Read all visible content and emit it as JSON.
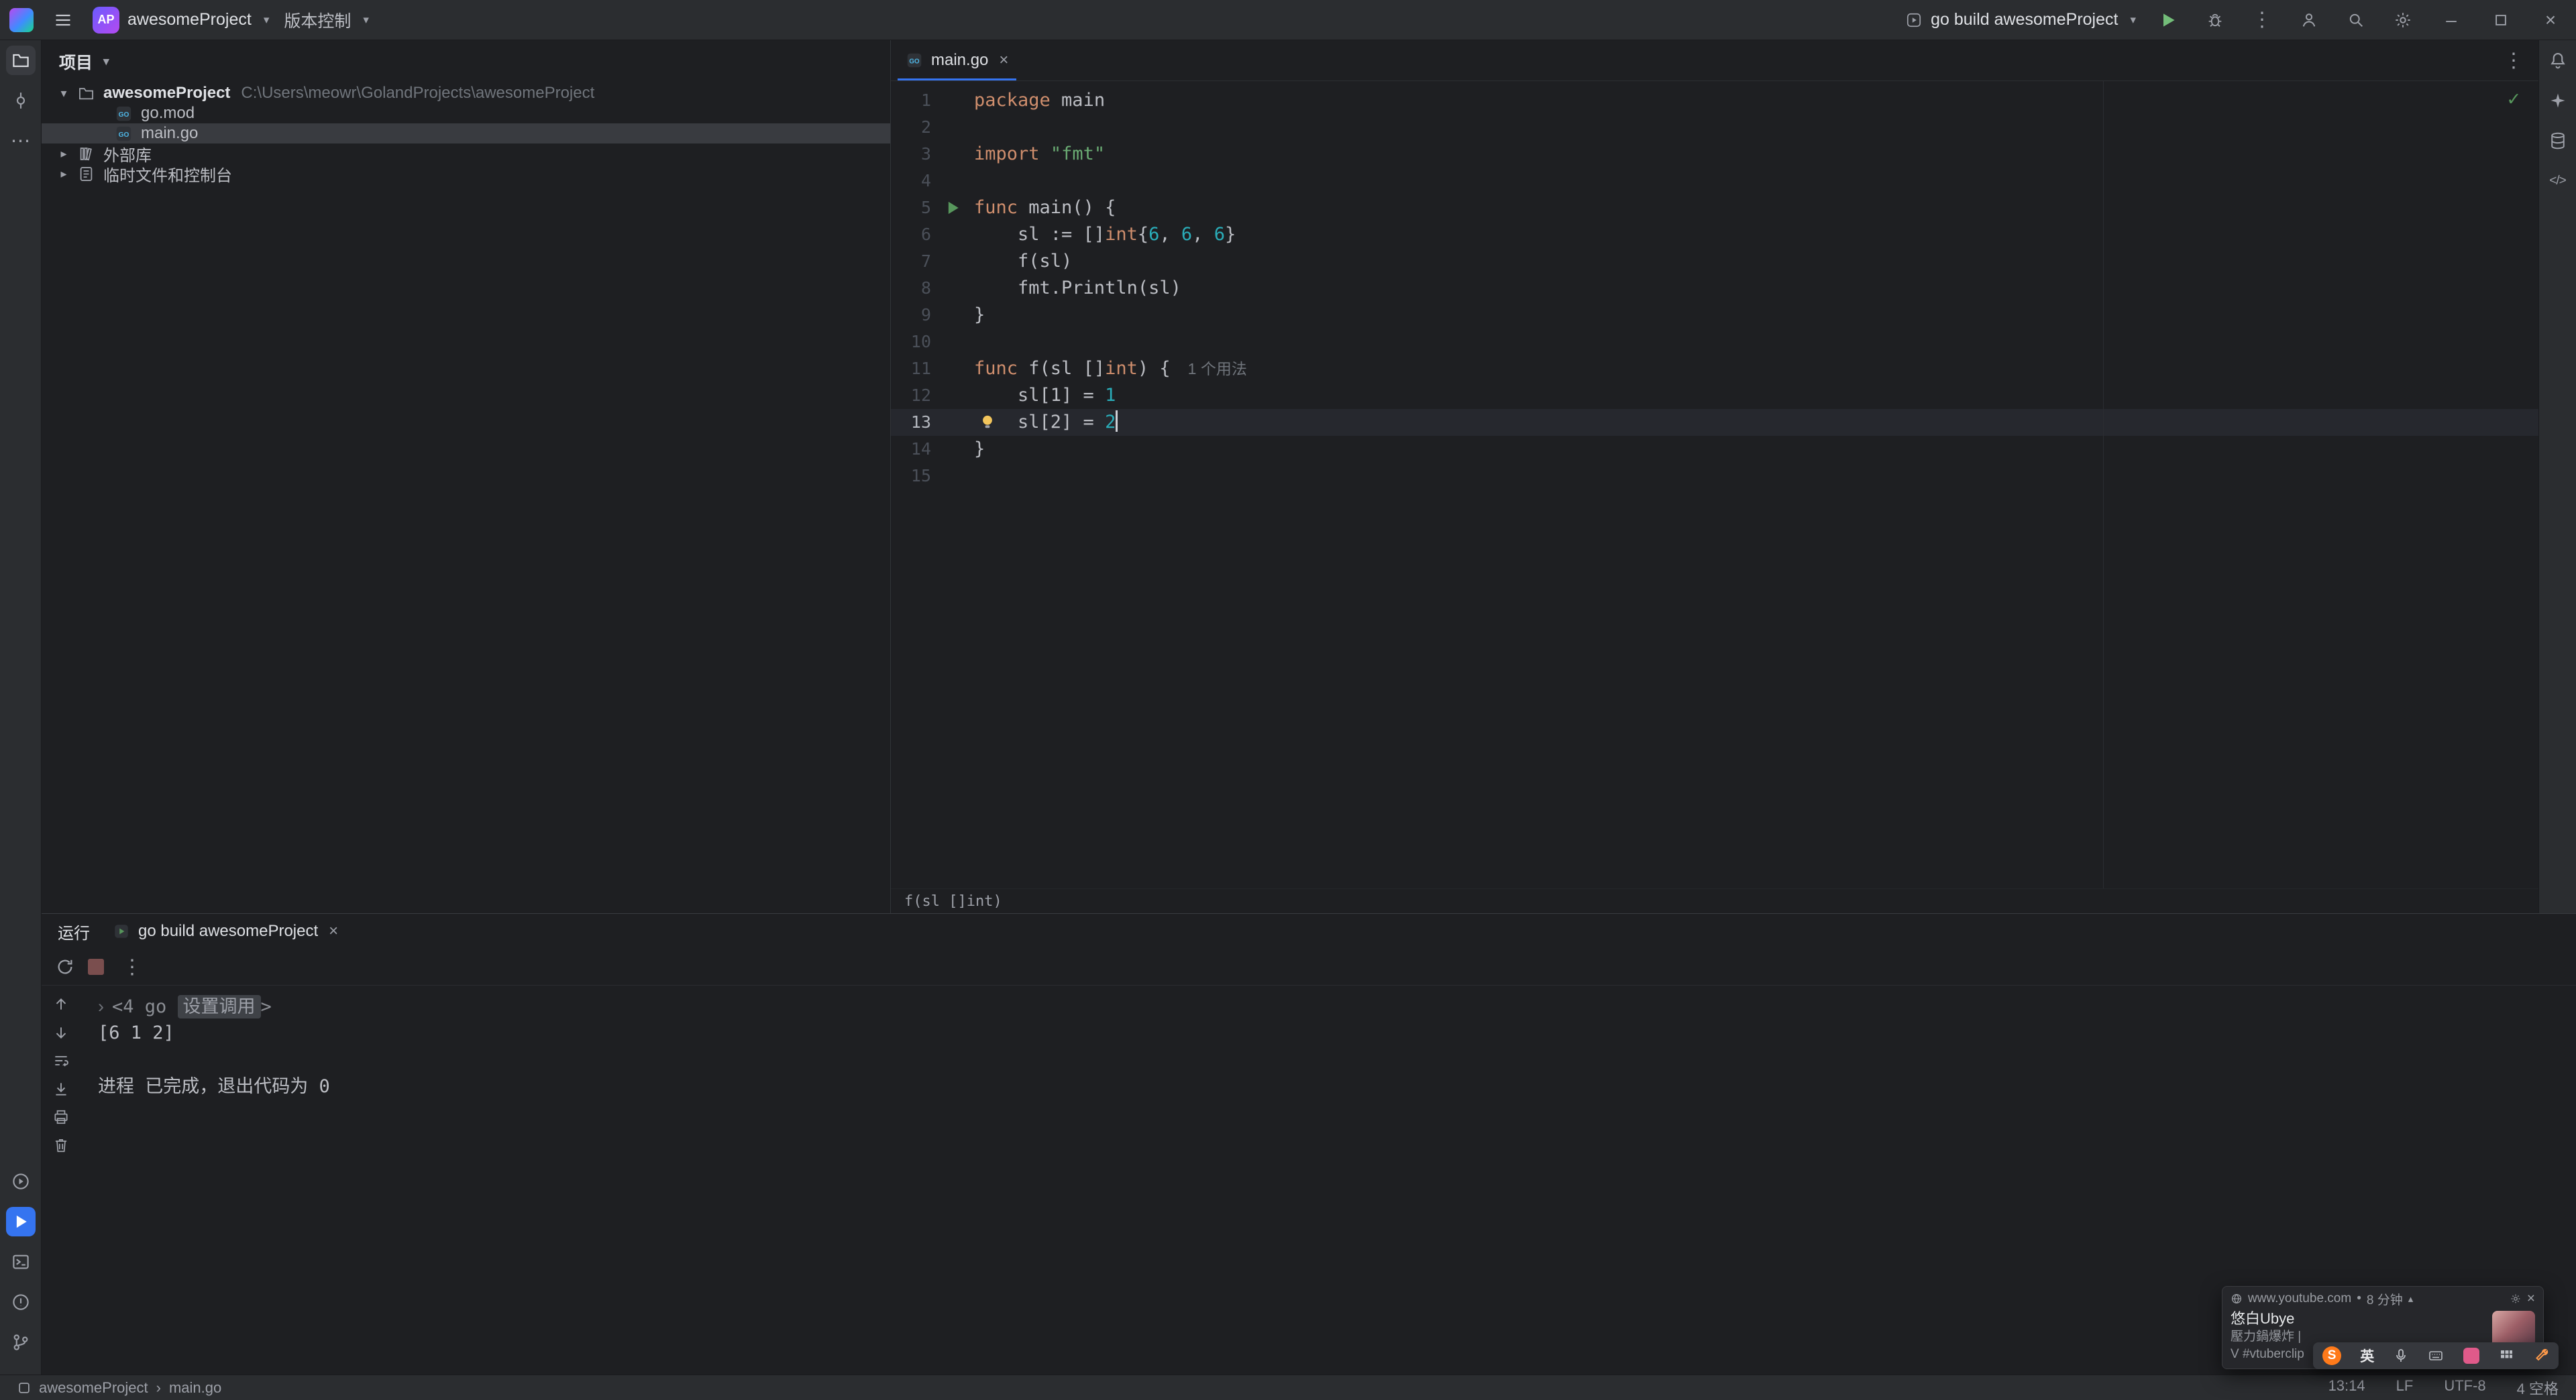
{
  "title_bar": {
    "project_name": "awesomeProject",
    "project_badge": "AP",
    "vcs_label": "版本控制",
    "run_config_label": "go build awesomeProject"
  },
  "project_panel": {
    "header_label": "项目",
    "items": [
      {
        "id": "root",
        "label": "awesomeProject",
        "path": "C:\\Users\\meowr\\GolandProjects\\awesomeProject",
        "icon": "folder",
        "level": 0,
        "chev": "open",
        "bold": true,
        "selected": false
      },
      {
        "id": "go-mod",
        "label": "go.mod",
        "icon": "gofile",
        "level": 1,
        "chev": "none",
        "bold": false,
        "selected": false
      },
      {
        "id": "main-go",
        "label": "main.go",
        "icon": "gofile",
        "level": 1,
        "chev": "none",
        "bold": false,
        "selected": true
      },
      {
        "id": "external-libraries",
        "label": "外部库",
        "icon": "library",
        "level": 0,
        "chev": "closed",
        "bold": false,
        "selected": false
      },
      {
        "id": "scratches",
        "label": "临时文件和控制台",
        "icon": "scratch",
        "level": 0,
        "chev": "closed",
        "bold": false,
        "selected": false
      }
    ]
  },
  "editor": {
    "tab_label": "main.go",
    "breadcrumb": "f(sl []int)",
    "lines": [
      {
        "n": 1,
        "segs": [
          [
            "kw",
            "package"
          ],
          [
            "d",
            " main"
          ]
        ]
      },
      {
        "n": 2,
        "segs": []
      },
      {
        "n": 3,
        "segs": [
          [
            "kw",
            "import"
          ],
          [
            "d",
            " "
          ],
          [
            "str",
            "\"fmt\""
          ]
        ]
      },
      {
        "n": 4,
        "segs": []
      },
      {
        "n": 5,
        "run": true,
        "segs": [
          [
            "kw",
            "func"
          ],
          [
            "d",
            " main() {"
          ]
        ]
      },
      {
        "n": 6,
        "segs": [
          [
            "d",
            "    sl := []"
          ],
          [
            "kw",
            "int"
          ],
          [
            "d",
            "{"
          ],
          [
            "num",
            "6"
          ],
          [
            "d",
            ", "
          ],
          [
            "num",
            "6"
          ],
          [
            "d",
            ", "
          ],
          [
            "num",
            "6"
          ],
          [
            "d",
            "}"
          ]
        ]
      },
      {
        "n": 7,
        "segs": [
          [
            "d",
            "    f(sl)"
          ]
        ]
      },
      {
        "n": 8,
        "segs": [
          [
            "d",
            "    fmt.Println(sl)"
          ]
        ]
      },
      {
        "n": 9,
        "segs": [
          [
            "d",
            "}"
          ]
        ]
      },
      {
        "n": 10,
        "segs": []
      },
      {
        "n": 11,
        "segs": [
          [
            "kw",
            "func"
          ],
          [
            "d",
            " f(sl []"
          ],
          [
            "kw",
            "int"
          ],
          [
            "d",
            ") {"
          ],
          [
            "hint",
            "1 个用法"
          ]
        ]
      },
      {
        "n": 12,
        "segs": [
          [
            "d",
            "    sl[1] = "
          ],
          [
            "num",
            "1"
          ]
        ]
      },
      {
        "n": 13,
        "current": true,
        "bulb": true,
        "segs": [
          [
            "d",
            "    sl[2] = "
          ],
          [
            "num",
            "2"
          ],
          [
            "caret",
            ""
          ]
        ]
      },
      {
        "n": 14,
        "segs": [
          [
            "d",
            "}"
          ]
        ]
      },
      {
        "n": 15,
        "segs": []
      }
    ]
  },
  "run_panel": {
    "title": "运行",
    "tab_label": "go build awesomeProject",
    "console": [
      {
        "segs": [
          [
            "chev",
            "›"
          ],
          [
            "meta",
            "<4 go "
          ],
          [
            "metabox",
            "设置调用"
          ],
          [
            "meta",
            ">"
          ]
        ]
      },
      {
        "segs": [
          [
            "out",
            "[6 1 2]"
          ]
        ]
      },
      {
        "segs": []
      },
      {
        "segs": [
          [
            "out",
            "进程 已完成，退出代码为 0"
          ]
        ]
      }
    ]
  },
  "status_bar": {
    "project": "awesomeProject",
    "file": "main.go",
    "right": [
      "13:14",
      "LF",
      "UTF-8",
      "4 空格"
    ]
  },
  "notification": {
    "site": "www.youtube.com",
    "bullet": "•",
    "time": "8 分钟",
    "channel": "悠白Ubye",
    "line1": "壓力鍋爆炸 |",
    "line2": "V #vtuberclip"
  },
  "ime": {
    "lang": "英"
  }
}
